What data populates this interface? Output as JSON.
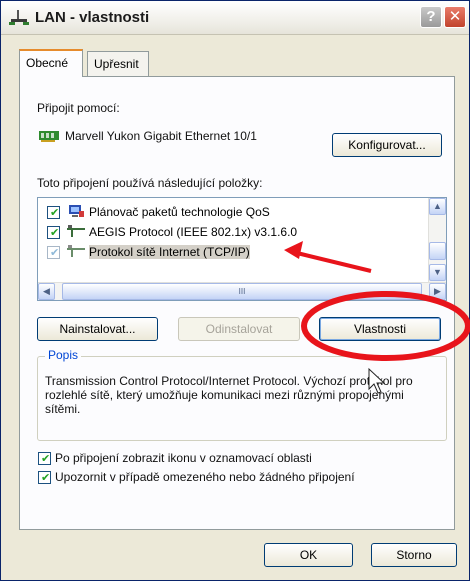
{
  "window": {
    "title": "LAN - vlastnosti",
    "help_glyph": "?",
    "close_glyph": "✕"
  },
  "tabs": [
    {
      "label": "Obecné",
      "active": true
    },
    {
      "label": "Upřesnit",
      "active": false
    }
  ],
  "connect_using": {
    "label": "Připojit pomocí:",
    "adapter": "Marvell Yukon Gigabit Ethernet 10/1",
    "configure_button": "Konfigurovat..."
  },
  "components": {
    "label": "Toto připojení používá následující položky:",
    "items": [
      {
        "label": "Plánovač paketů technologie QoS",
        "checked": true,
        "icon": "qos-scheduler-icon"
      },
      {
        "label": "AEGIS Protocol (IEEE 802.1x) v3.1.6.0",
        "checked": true,
        "icon": "network-protocol-icon"
      },
      {
        "label": "Protokol sítě Internet (TCP/IP)",
        "checked": true,
        "icon": "network-protocol-icon",
        "selected": true
      }
    ],
    "hscroll_thumb": "III"
  },
  "buttons": {
    "install": "Nainstalovat...",
    "uninstall": "Odinstalovat",
    "properties": "Vlastnosti"
  },
  "description": {
    "legend": "Popis",
    "text": "Transmission Control Protocol/Internet Protocol. Výchozí protokol pro rozlehlé sítě, který umožňuje komunikaci mezi různými propojenými sítěmi."
  },
  "options": [
    {
      "label": "Po připojení zobrazit ikonu v oznamovací oblasti",
      "checked": true
    },
    {
      "label": "Upozornit v případě omezeného nebo žádného připojení",
      "checked": true
    }
  ],
  "footer": {
    "ok": "OK",
    "cancel": "Storno"
  },
  "colors": {
    "annotation_red": "#e8141b",
    "link_blue": "#0046d5"
  }
}
